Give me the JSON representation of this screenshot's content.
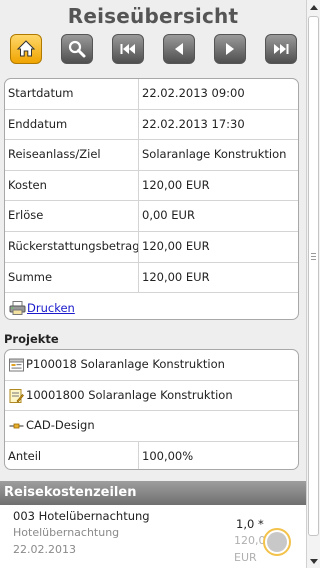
{
  "header": {
    "title": "Reiseübersicht"
  },
  "toolbar": {
    "buttons": [
      {
        "icon": "home-icon"
      },
      {
        "icon": "search-icon"
      },
      {
        "icon": "first-icon"
      },
      {
        "icon": "previous-icon"
      },
      {
        "icon": "next-icon"
      },
      {
        "icon": "last-icon"
      }
    ]
  },
  "summary": {
    "rows": [
      {
        "label": "Startdatum",
        "value": "22.02.2013 09:00"
      },
      {
        "label": "Enddatum",
        "value": "22.02.2013 17:30"
      },
      {
        "label": "Reiseanlass/Ziel",
        "value": "Solaranlage Konstruktion"
      },
      {
        "label": "Kosten",
        "value": "120,00 EUR"
      },
      {
        "label": "Erlöse",
        "value": "0,00 EUR"
      },
      {
        "label": "Rückerstattungsbetrag",
        "value": "120,00 EUR"
      },
      {
        "label": "Summe",
        "value": "120,00 EUR"
      }
    ],
    "print_link": "Drucken"
  },
  "projects": {
    "label": "Projekte",
    "items": [
      {
        "icon": "project-icon",
        "text": "P100018 Solaranlage Konstruktion"
      },
      {
        "icon": "task-icon",
        "text": "10001800 Solaranlage Konstruktion"
      },
      {
        "icon": "activity-icon",
        "text": "CAD-Design"
      }
    ],
    "share_label": "Anteil",
    "share_value": "100,00%"
  },
  "cost_lines": {
    "header": "Reisekostenzeilen",
    "items": [
      {
        "title": "003 Hotelübernachtung",
        "subtitle": "Hotelübernachtung",
        "date": "22.02.2013",
        "quantity": "1,0 *",
        "amount": "120,0",
        "currency": "EUR"
      }
    ]
  },
  "colors": {
    "accent": "#f0a400",
    "header_bar": "#7a7a7a",
    "link": "#1a1acc"
  }
}
